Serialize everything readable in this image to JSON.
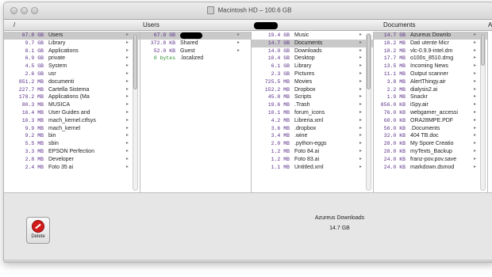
{
  "window": {
    "title": "Macintosh HD – 100.6 GB"
  },
  "columns": {
    "headers": [
      "/",
      "Users",
      "",
      "Documents",
      "A"
    ]
  },
  "col1": [
    {
      "size": "67.8 GB",
      "name": "Users",
      "sel": true
    },
    {
      "size": "9.7 GB",
      "name": "Library"
    },
    {
      "size": "8.1 GB",
      "name": "Applications"
    },
    {
      "size": "6.9 GB",
      "name": "private"
    },
    {
      "size": "4.5 GB",
      "name": "System"
    },
    {
      "size": "2.6 GB",
      "name": "usr"
    },
    {
      "size": "851.2 MB",
      "name": "documenti"
    },
    {
      "size": "227.7 MB",
      "name": "Cartella Sistema"
    },
    {
      "size": "178.2 MB",
      "name": "Applications (Ma"
    },
    {
      "size": "80.3 MB",
      "name": "MUSICA"
    },
    {
      "size": "16.4 MB",
      "name": "User Guides and"
    },
    {
      "size": "10.3 MB",
      "name": "mach_kernel.ctfsys"
    },
    {
      "size": "9.9 MB",
      "name": "mach_kernel"
    },
    {
      "size": "9.2 MB",
      "name": "bin"
    },
    {
      "size": "5.5 MB",
      "name": "sbin"
    },
    {
      "size": "3.3 MB",
      "name": "EPSON Perfection"
    },
    {
      "size": "2.8 MB",
      "name": "Developer"
    },
    {
      "size": "2.4 MB",
      "name": "Foto 35 ai"
    }
  ],
  "col2": [
    {
      "size": "67.8 GB",
      "name": "",
      "sel": true,
      "redacted": true
    },
    {
      "size": "372.8 KB",
      "name": "Shared"
    },
    {
      "size": "52.0 KB",
      "name": "Guest"
    },
    {
      "size": "0 bytes",
      "name": ".localized",
      "green": true
    }
  ],
  "col3": [
    {
      "size": "19.4 GB",
      "name": "Music"
    },
    {
      "size": "14.7 GB",
      "name": "Documents",
      "sel": true
    },
    {
      "size": "14.0 GB",
      "name": "Downloads"
    },
    {
      "size": "10.4 GB",
      "name": "Desktop"
    },
    {
      "size": "6.1 GB",
      "name": "Library"
    },
    {
      "size": "2.3 GB",
      "name": "Pictures"
    },
    {
      "size": "725.5 MB",
      "name": "Movies"
    },
    {
      "size": "152.2 MB",
      "name": "Dropbox"
    },
    {
      "size": "45.8 MB",
      "name": "Scripts"
    },
    {
      "size": "19.6 MB",
      "name": ".Trash"
    },
    {
      "size": "10.1 MB",
      "name": "forum_icons"
    },
    {
      "size": "4.2 MB",
      "name": "Libreria.xml"
    },
    {
      "size": "3.6 MB",
      "name": ".dropbox"
    },
    {
      "size": "3.4 MB",
      "name": ".wine"
    },
    {
      "size": "2.0 MB",
      "name": ".python-eggs"
    },
    {
      "size": "1.2 MB",
      "name": "Foto 84.ai"
    },
    {
      "size": "1.2 MB",
      "name": "Foto 83.ai"
    },
    {
      "size": "1.1 MB",
      "name": "Untitled.xml"
    }
  ],
  "col4": [
    {
      "size": "14.7 GB",
      "name": "Azureus Downlo",
      "sel": true
    },
    {
      "size": "18.2 MB",
      "name": "Dati utente Micr"
    },
    {
      "size": "18.2 MB",
      "name": "vlc-0.9.9-intel.dm"
    },
    {
      "size": "17.7 MB",
      "name": "o100s_8510.dmg"
    },
    {
      "size": "13.5 MB",
      "name": "Incoming News"
    },
    {
      "size": "11.1 MB",
      "name": "Output scanner"
    },
    {
      "size": "3.8 MB",
      "name": "AlertThingy.air"
    },
    {
      "size": "2.2 MB",
      "name": "dialysis2.ai"
    },
    {
      "size": "1.9 MB",
      "name": "Snackr"
    },
    {
      "size": "856.0 KB",
      "name": "iSpy.air"
    },
    {
      "size": "76.0 KB",
      "name": "webgamer_accessi"
    },
    {
      "size": "60.0 KB",
      "name": "ORA28MPE.PDF"
    },
    {
      "size": "56.0 KB",
      "name": ".Documents"
    },
    {
      "size": "32.0 KB",
      "name": "404 TB.doc"
    },
    {
      "size": "28.0 KB",
      "name": "My Spore Creatio"
    },
    {
      "size": "28.0 KB",
      "name": "myTexts_Backup"
    },
    {
      "size": "24.0 KB",
      "name": "franz-pov.pov.save"
    },
    {
      "size": "24.0 KB",
      "name": "markdown.dsmod"
    }
  ],
  "info": {
    "name": "Azureus Downloads",
    "size": "14.7 GB",
    "delete_label": "Delete"
  },
  "icons": [
    "folder-icon",
    "delete-icon",
    "chevron-right-icon"
  ]
}
